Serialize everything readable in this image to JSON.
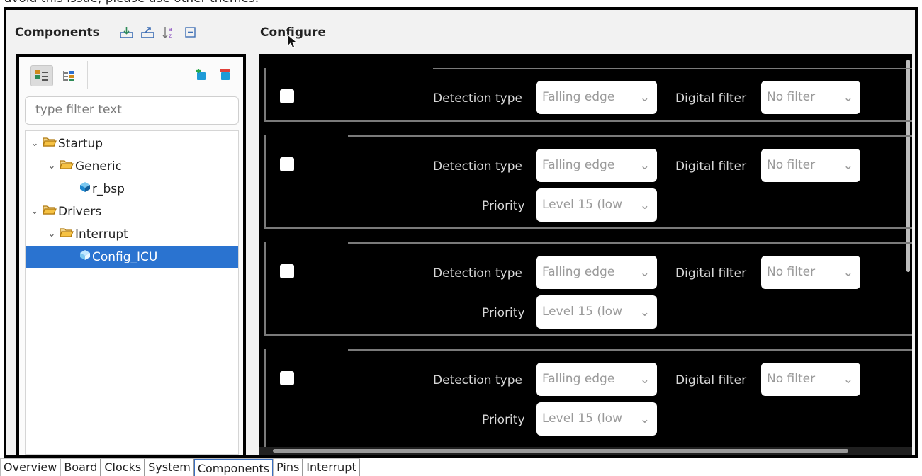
{
  "caption": "avoid this issue, please use other themes.",
  "components": {
    "title": "Components",
    "tools": [
      "import-icon",
      "export-icon",
      "sort-icon",
      "collapse-all-icon"
    ],
    "view_tabs": [
      "components-view-icon",
      "hierarchy-view-icon"
    ],
    "right_tools": [
      "add-component-icon",
      "remove-component-icon"
    ],
    "filter_placeholder": "type filter text",
    "tree": [
      {
        "label": "Startup",
        "level": 0,
        "type": "folder",
        "expanded": true
      },
      {
        "label": "Generic",
        "level": 1,
        "type": "folder",
        "expanded": true
      },
      {
        "label": "r_bsp",
        "level": 2,
        "type": "component"
      },
      {
        "label": "Drivers",
        "level": 0,
        "type": "folder",
        "expanded": true
      },
      {
        "label": "Interrupt",
        "level": 1,
        "type": "folder",
        "expanded": true
      },
      {
        "label": "Config_ICU",
        "level": 2,
        "type": "component",
        "selected": true
      }
    ]
  },
  "configure": {
    "title": "Configure",
    "labels": {
      "detection_type": "Detection type",
      "digital_filter": "Digital filter",
      "priority": "Priority"
    },
    "rows": [
      {
        "detection": "Falling edge",
        "filter": "No filter",
        "priority": null
      },
      {
        "detection": "Falling edge",
        "filter": "No filter",
        "priority": "Level 15 (low"
      },
      {
        "detection": "Falling edge",
        "filter": "No filter",
        "priority": "Level 15 (low"
      },
      {
        "detection": "Falling edge",
        "filter": "No filter",
        "priority": "Level 15 (low"
      }
    ]
  },
  "bottom_tabs": [
    "Overview",
    "Board",
    "Clocks",
    "System",
    "Components",
    "Pins",
    "Interrupt"
  ],
  "active_tab": "Components"
}
